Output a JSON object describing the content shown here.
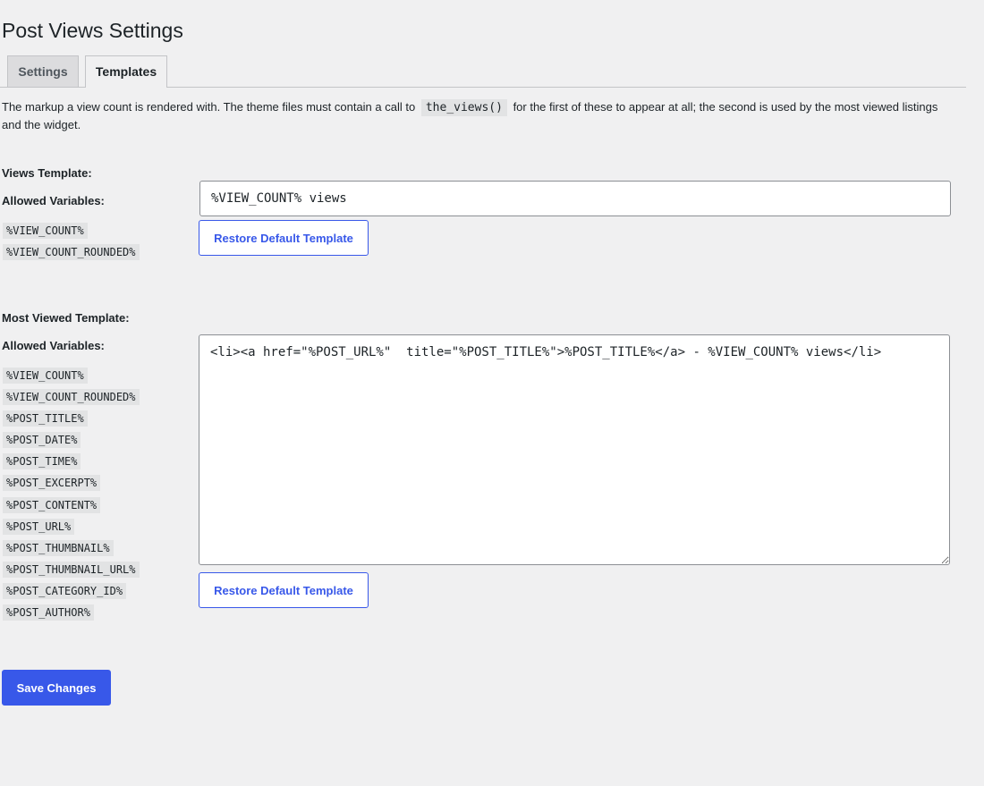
{
  "page": {
    "title": "Post Views Settings"
  },
  "tabs": [
    {
      "label": "Settings",
      "active": false
    },
    {
      "label": "Templates",
      "active": true
    }
  ],
  "description": {
    "before": "The markup a view count is rendered with. The theme files must contain a call to",
    "code": "the_views()",
    "after": "for the first of these to appear at all; the second is used by the most viewed listings and the widget."
  },
  "views_template": {
    "title": "Views Template:",
    "allowed_label": "Allowed Variables:",
    "variables": [
      "%VIEW_COUNT%",
      "%VIEW_COUNT_ROUNDED%"
    ],
    "value": "%VIEW_COUNT% views",
    "restore_label": "Restore Default Template"
  },
  "most_viewed_template": {
    "title": "Most Viewed Template:",
    "allowed_label": "Allowed Variables:",
    "variables": [
      "%VIEW_COUNT%",
      "%VIEW_COUNT_ROUNDED%",
      "%POST_TITLE%",
      "%POST_DATE%",
      "%POST_TIME%",
      "%POST_EXCERPT%",
      "%POST_CONTENT%",
      "%POST_URL%",
      "%POST_THUMBNAIL%",
      "%POST_THUMBNAIL_URL%",
      "%POST_CATEGORY_ID%",
      "%POST_AUTHOR%"
    ],
    "value": "<li><a href=\"%POST_URL%\"  title=\"%POST_TITLE%\">%POST_TITLE%</a> - %VIEW_COUNT% views</li>",
    "restore_label": "Restore Default Template"
  },
  "save_label": "Save Changes",
  "colors": {
    "accent": "#3858e9",
    "background": "#f0f0f1",
    "code_bg": "#e2e3e4"
  }
}
